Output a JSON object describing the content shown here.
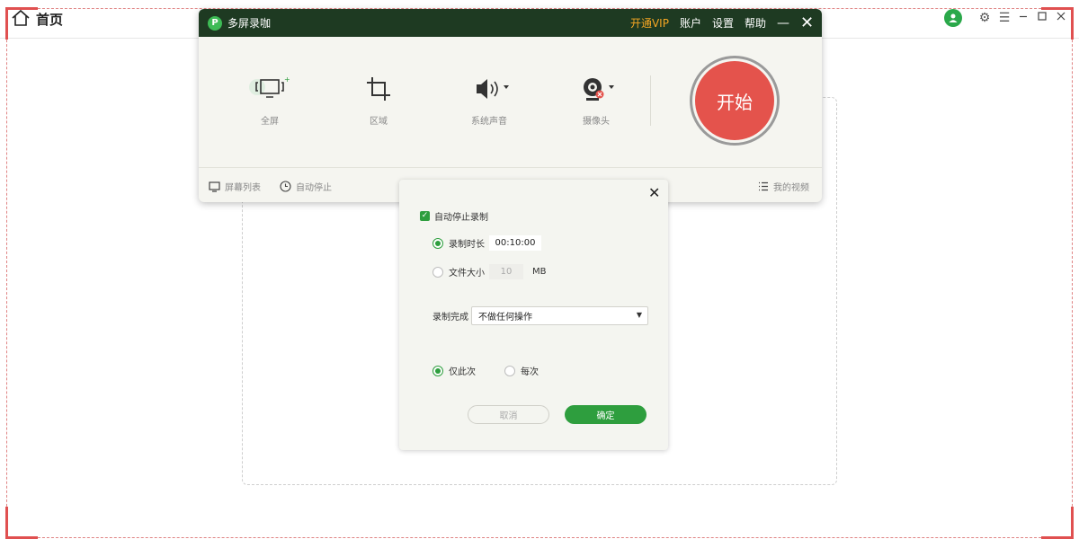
{
  "home": {
    "title": "首页"
  },
  "recorder": {
    "app_title": "多屏录咖",
    "menu": {
      "vip": "开通VIP",
      "account": "账户",
      "settings": "设置",
      "help": "帮助"
    },
    "tools": {
      "fullscreen": "全屏",
      "region": "区域",
      "system_audio": "系统声音",
      "camera": "摄像头"
    },
    "start_label": "开始",
    "bottom": {
      "screen_list": "屏幕列表",
      "auto_stop": "自动停止",
      "my_videos": "我的视频"
    }
  },
  "dialog": {
    "enable_label": "自动停止录制",
    "duration_label": "录制时长",
    "duration_value": "00:10:00",
    "file_size_label": "文件大小",
    "file_size_value": "10",
    "file_size_unit": "MB",
    "on_complete_label": "录制完成",
    "on_complete_value": "不做任何操作",
    "once_label": "仅此次",
    "every_label": "每次",
    "cancel_label": "取消",
    "ok_label": "确定"
  },
  "colors": {
    "accent_green": "#2e9e3e",
    "titlebar": "#1e3a22",
    "start_red": "#e4534c",
    "vip_orange": "#f5a623",
    "frame_red": "#e05050"
  }
}
